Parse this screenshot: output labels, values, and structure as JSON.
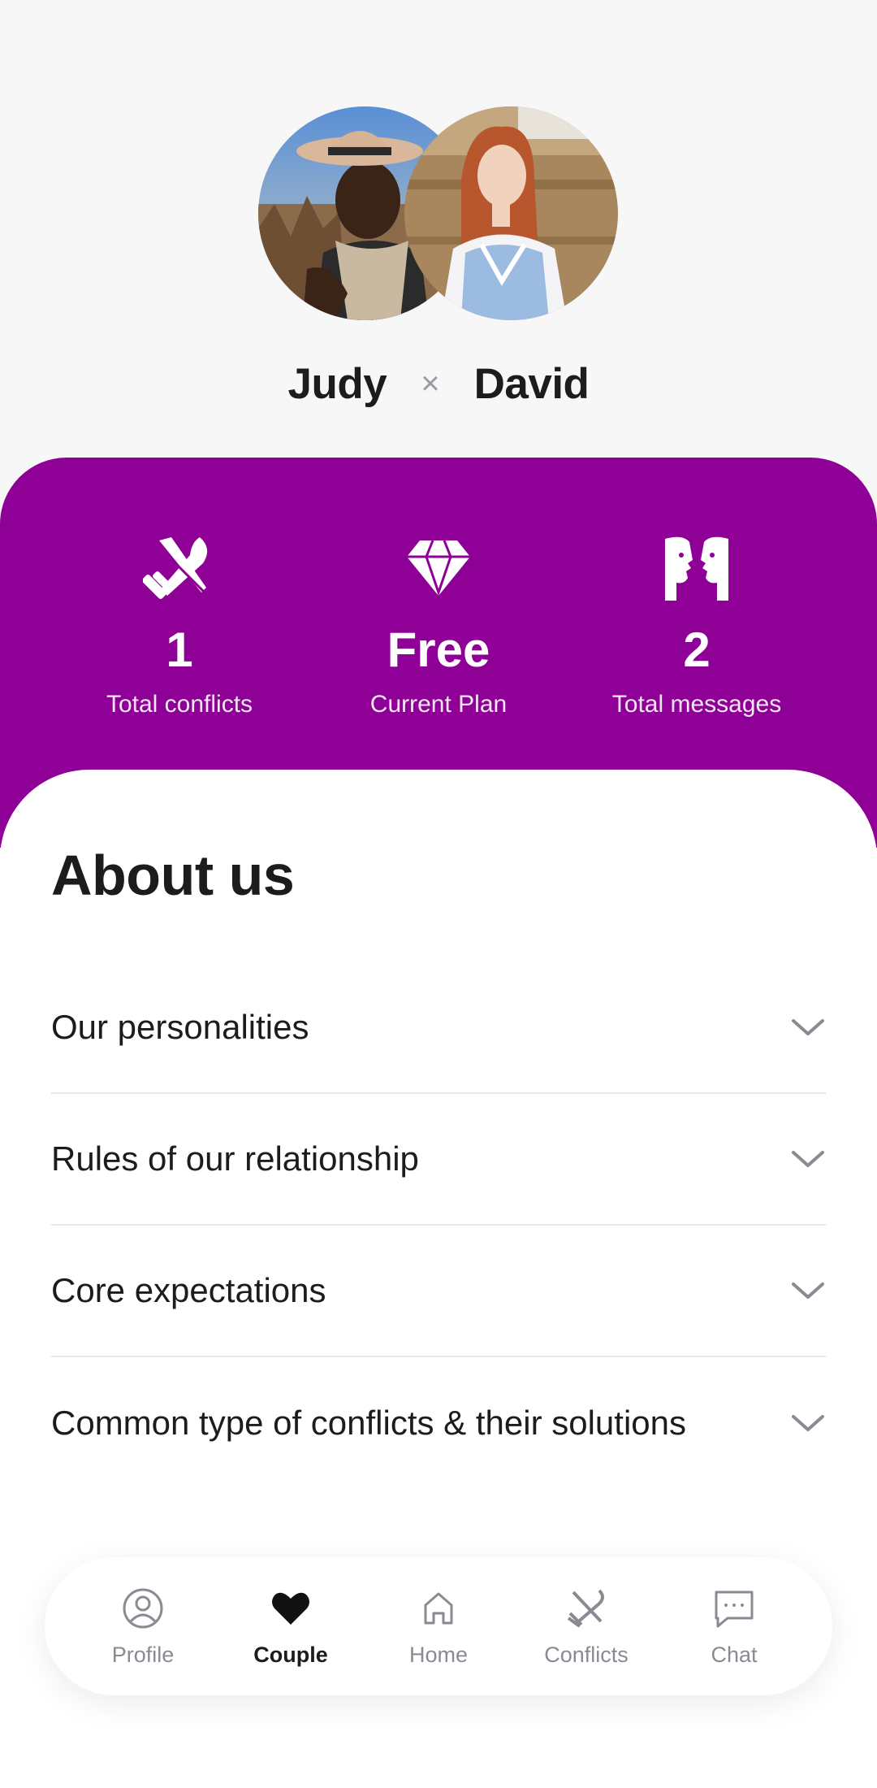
{
  "couple": {
    "partner_one": "Judy",
    "separator": "×",
    "partner_two": "David"
  },
  "stats": [
    {
      "icon": "crossed-swords-icon",
      "value": "1",
      "label": "Total conflicts"
    },
    {
      "icon": "diamond-icon",
      "value": "Free",
      "label": "Current Plan"
    },
    {
      "icon": "faces-talking-icon",
      "value": "2",
      "label": "Total messages"
    }
  ],
  "about": {
    "title": "About us",
    "items": [
      {
        "label": "Our personalities"
      },
      {
        "label": "Rules of our relationship"
      },
      {
        "label": "Core expectations"
      },
      {
        "label": "Common type of conflicts & their solutions"
      }
    ]
  },
  "tabbar": {
    "tabs": [
      {
        "label": "Profile",
        "icon": "person-circle-icon",
        "active": false
      },
      {
        "label": "Couple",
        "icon": "heart-icon",
        "active": true
      },
      {
        "label": "Home",
        "icon": "home-icon",
        "active": false
      },
      {
        "label": "Conflicts",
        "icon": "crossed-swords-icon",
        "active": false
      },
      {
        "label": "Chat",
        "icon": "chat-bubble-icon",
        "active": false
      }
    ]
  },
  "colors": {
    "accent": "#8e0096",
    "text": "#1c1c1e",
    "muted": "#8a8a93"
  }
}
